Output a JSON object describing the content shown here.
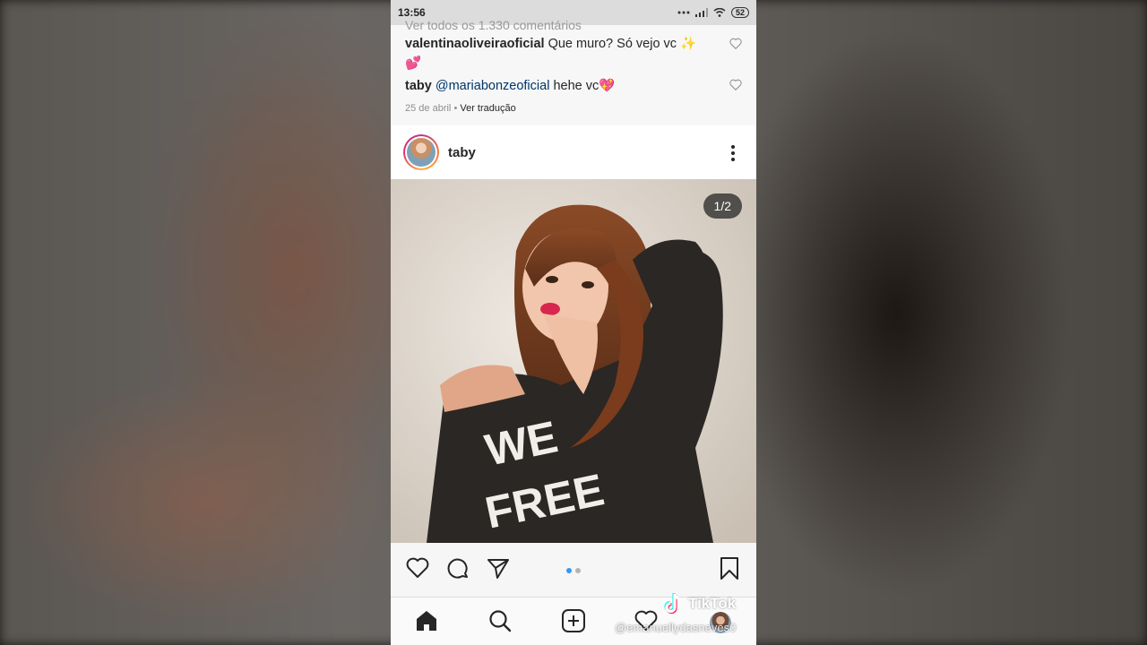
{
  "status_bar": {
    "time": "13:56",
    "battery": "52"
  },
  "comments": {
    "view_all": "Ver todos os 1.330 comentários",
    "items": [
      {
        "user": "valentinaoliveiraoficial",
        "text": "Que muro? Só vejo vc ✨💕"
      },
      {
        "user": "taby",
        "mention": "@mariabonzeoficial",
        "text": "hehe vc💖"
      }
    ],
    "date": "25 de abril",
    "separator": "•",
    "translate": "Ver tradução"
  },
  "post": {
    "username": "taby",
    "counter": "1/2",
    "shirt_text_1": "WE",
    "shirt_text_2": "FREE"
  },
  "watermark": {
    "brand": "TikTok",
    "user": "@emanuellydasneves0"
  },
  "icons": [
    "heart-icon",
    "comment-icon",
    "share-icon",
    "bookmark-icon",
    "home-icon",
    "search-icon",
    "add-post-icon",
    "activity-icon",
    "more-icon"
  ],
  "colors": {
    "accent": "#3897f0",
    "mention": "#003569",
    "text": "#262626",
    "muted": "#8e8e8e"
  }
}
